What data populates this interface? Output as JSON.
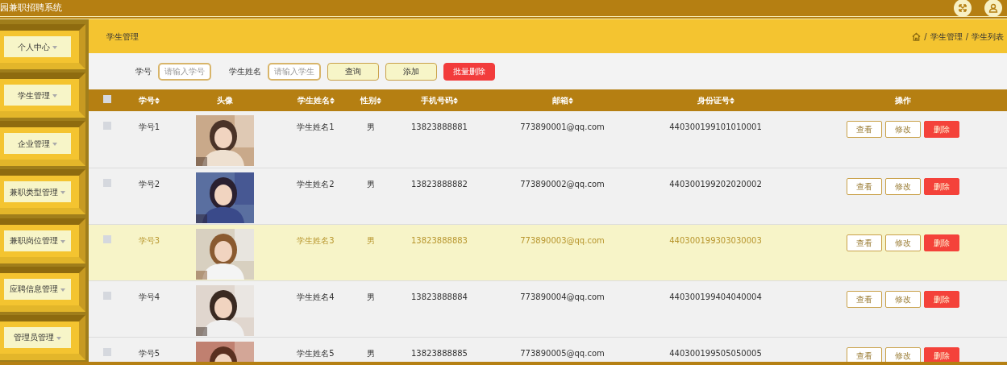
{
  "app": {
    "title": "园兼职招聘系统"
  },
  "sidebar": {
    "items": [
      {
        "label": "个人中心"
      },
      {
        "label": "学生管理"
      },
      {
        "label": "企业管理"
      },
      {
        "label": "兼职类型管理"
      },
      {
        "label": "兼职岗位管理"
      },
      {
        "label": "应聘信息管理"
      },
      {
        "label": "管理员管理"
      }
    ]
  },
  "page": {
    "title": "学生管理",
    "breadcrumb": [
      {
        "separator": "/",
        "label": "学生管理"
      },
      {
        "separator": "/",
        "label": "学生列表"
      }
    ]
  },
  "search": {
    "fields": [
      {
        "label": "学号",
        "placeholder": "请输入学号"
      },
      {
        "label": "学生姓名",
        "placeholder": "请输入学生"
      }
    ],
    "buttons": [
      {
        "label": "查询",
        "kind": "default"
      },
      {
        "label": "添加",
        "kind": "default"
      },
      {
        "label": "批量删除",
        "kind": "danger"
      }
    ]
  },
  "table": {
    "select_all": {
      "checked": false
    },
    "columns": [
      {
        "label": "学号",
        "sortable": true
      },
      {
        "label": "头像",
        "sortable": false
      },
      {
        "label": "学生姓名",
        "sortable": true
      },
      {
        "label": "性别",
        "sortable": true
      },
      {
        "label": "手机号码",
        "sortable": true
      },
      {
        "label": "邮箱",
        "sortable": true
      },
      {
        "label": "身份证号",
        "sortable": true
      },
      {
        "label": "操作",
        "sortable": false
      }
    ],
    "rows": [
      {
        "checked": false,
        "highlighted": false,
        "cells": [
          "学号1",
          "",
          "学生姓名1",
          "男",
          "13823888881",
          "773890001@qq.com",
          "440300199101010001"
        ],
        "actions": [
          {
            "label": "查看",
            "kind": "default"
          },
          {
            "label": "修改",
            "kind": "default"
          },
          {
            "label": "删除",
            "kind": "danger"
          }
        ]
      },
      {
        "checked": false,
        "highlighted": false,
        "cells": [
          "学号2",
          "",
          "学生姓名2",
          "男",
          "13823888882",
          "773890002@qq.com",
          "440300199202020002"
        ],
        "actions": [
          {
            "label": "查看",
            "kind": "default"
          },
          {
            "label": "修改",
            "kind": "default"
          },
          {
            "label": "删除",
            "kind": "danger"
          }
        ]
      },
      {
        "checked": false,
        "highlighted": true,
        "cells": [
          "学号3",
          "",
          "学生姓名3",
          "男",
          "13823888883",
          "773890003@qq.com",
          "440300199303030003"
        ],
        "actions": [
          {
            "label": "查看",
            "kind": "default"
          },
          {
            "label": "修改",
            "kind": "default"
          },
          {
            "label": "删除",
            "kind": "danger"
          }
        ]
      },
      {
        "checked": false,
        "highlighted": false,
        "cells": [
          "学号4",
          "",
          "学生姓名4",
          "男",
          "13823888884",
          "773890004@qq.com",
          "440300199404040004"
        ],
        "actions": [
          {
            "label": "查看",
            "kind": "default"
          },
          {
            "label": "修改",
            "kind": "default"
          },
          {
            "label": "删除",
            "kind": "danger"
          }
        ]
      },
      {
        "checked": false,
        "highlighted": false,
        "cells": [
          "学号5",
          "",
          "学生姓名5",
          "男",
          "13823888885",
          "773890005@qq.com",
          "440300199505050005"
        ],
        "actions": [
          {
            "label": "查看",
            "kind": "default"
          },
          {
            "label": "修改",
            "kind": "default"
          },
          {
            "label": "删除",
            "kind": "danger"
          }
        ]
      }
    ]
  }
}
